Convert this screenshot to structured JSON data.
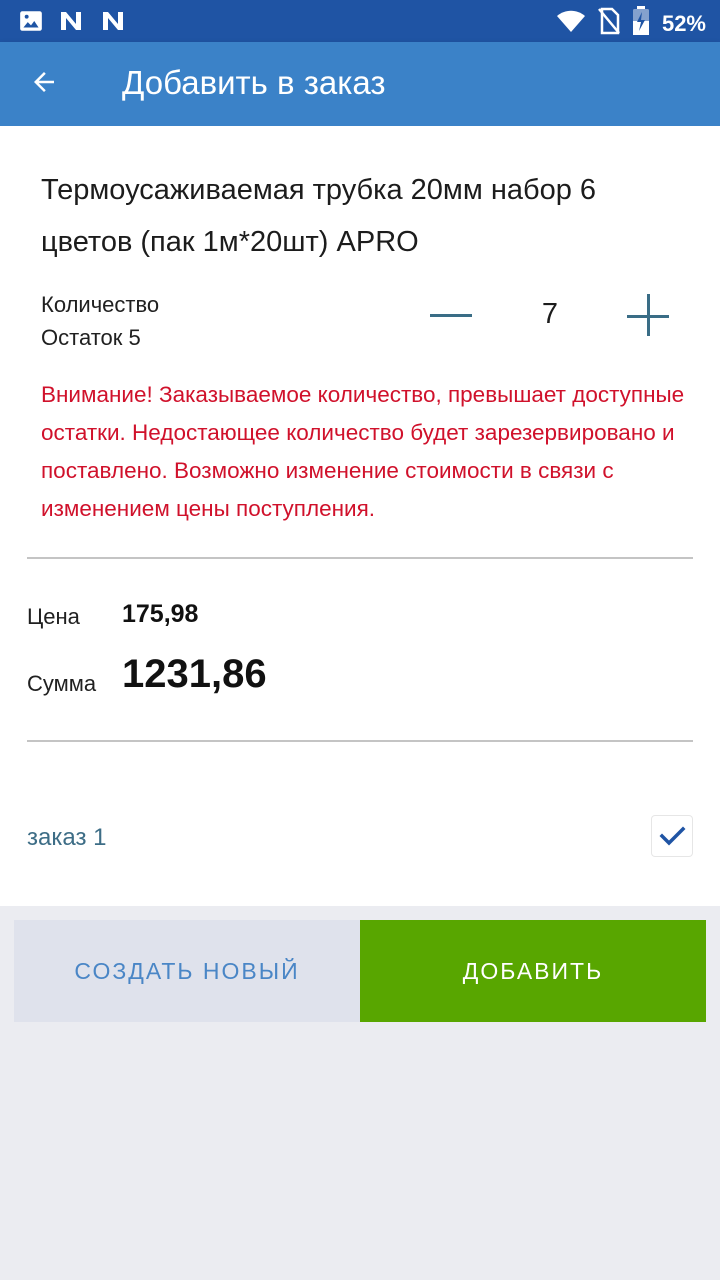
{
  "status_bar": {
    "battery_percent": "52%",
    "icons": [
      "image-icon",
      "n-notification-icon",
      "n-notification-icon",
      "wifi-icon",
      "no-sim-icon",
      "battery-charging-icon"
    ]
  },
  "app_bar": {
    "back_icon": "arrow-left-icon",
    "title": "Добавить в заказ"
  },
  "product": {
    "name": "Термоусаживаемая трубка 20мм набор 6 цветов (пак 1м*20шт) APRO"
  },
  "quantity": {
    "label": "Количество",
    "stock_label": "Остаток 5",
    "value": "7",
    "minus_icon": "minus-icon",
    "plus_icon": "plus-icon"
  },
  "warning_text": "Внимание! Заказываемое количество, превышает доступные остатки. Недостающее количество будет зарезервировано и поставлено. Возможно изменение стоимости в связи с изменением цены поступления.",
  "pricing": {
    "price_label": "Цена",
    "price_value": "175,98",
    "sum_label": "Сумма",
    "sum_value": "1231,86"
  },
  "order": {
    "name": "заказ 1",
    "checked": true
  },
  "buttons": {
    "create_new": "Создать новый",
    "add": "Добавить"
  },
  "colors": {
    "status_bar": "#1f54a4",
    "app_bar": "#3b82c8",
    "warning": "#d0112b",
    "add_button": "#58a600",
    "create_button_bg": "#dfe2ec",
    "create_button_text": "#4a86c6",
    "stepper_icon": "#3a6d86"
  }
}
